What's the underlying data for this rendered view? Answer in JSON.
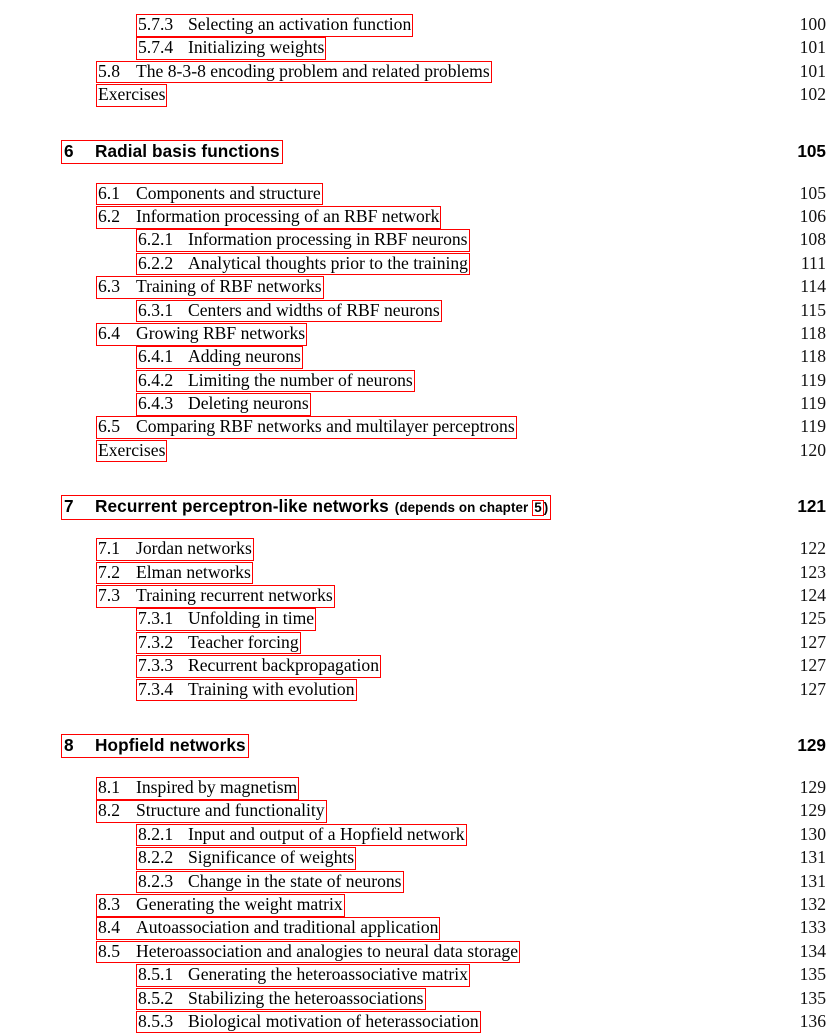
{
  "document": {
    "type": "table-of-contents",
    "accent_box_color": "#ff0000",
    "text_color": "#000000",
    "background": "#ffffff"
  },
  "blocks": [
    {
      "kind": "entries",
      "rows": [
        {
          "level": 3,
          "number": "5.7.3",
          "title": "Selecting an activation function",
          "page": "100"
        },
        {
          "level": 3,
          "number": "5.7.4",
          "title": "Initializing weights",
          "page": "101"
        },
        {
          "level": 2,
          "number": "5.8",
          "title": "The 8-3-8 encoding problem and related problems",
          "page": "101"
        },
        {
          "level": 2,
          "number": "",
          "title": "Exercises",
          "page": "102"
        }
      ]
    },
    {
      "kind": "chapter",
      "chapter": {
        "number": "6",
        "title": "Radial basis functions",
        "page": "105",
        "note_before": "",
        "note_ref": "",
        "note_after": ""
      },
      "rows": [
        {
          "level": 2,
          "number": "6.1",
          "title": "Components and structure",
          "page": "105"
        },
        {
          "level": 2,
          "number": "6.2",
          "title": "Information processing of an RBF network",
          "page": "106"
        },
        {
          "level": 3,
          "number": "6.2.1",
          "title": "Information processing in RBF neurons",
          "page": "108"
        },
        {
          "level": 3,
          "number": "6.2.2",
          "title": "Analytical thoughts prior to the training",
          "page": "111"
        },
        {
          "level": 2,
          "number": "6.3",
          "title": "Training of RBF networks",
          "page": "114"
        },
        {
          "level": 3,
          "number": "6.3.1",
          "title": "Centers and widths of RBF neurons",
          "page": "115"
        },
        {
          "level": 2,
          "number": "6.4",
          "title": "Growing RBF networks",
          "page": "118"
        },
        {
          "level": 3,
          "number": "6.4.1",
          "title": "Adding neurons",
          "page": "118"
        },
        {
          "level": 3,
          "number": "6.4.2",
          "title": "Limiting the number of neurons",
          "page": "119"
        },
        {
          "level": 3,
          "number": "6.4.3",
          "title": "Deleting neurons",
          "page": "119"
        },
        {
          "level": 2,
          "number": "6.5",
          "title": "Comparing RBF networks and multilayer perceptrons",
          "page": "119"
        },
        {
          "level": 2,
          "number": "",
          "title": "Exercises",
          "page": "120"
        }
      ]
    },
    {
      "kind": "chapter",
      "chapter": {
        "number": "7",
        "title": "Recurrent perceptron-like networks",
        "page": "121",
        "note_before": "(depends on chapter ",
        "note_ref": "5",
        "note_after": ")"
      },
      "rows": [
        {
          "level": 2,
          "number": "7.1",
          "title": "Jordan networks",
          "page": "122"
        },
        {
          "level": 2,
          "number": "7.2",
          "title": "Elman networks",
          "page": "123"
        },
        {
          "level": 2,
          "number": "7.3",
          "title": "Training recurrent networks",
          "page": "124"
        },
        {
          "level": 3,
          "number": "7.3.1",
          "title": "Unfolding in time",
          "page": "125"
        },
        {
          "level": 3,
          "number": "7.3.2",
          "title": "Teacher forcing",
          "page": "127"
        },
        {
          "level": 3,
          "number": "7.3.3",
          "title": "Recurrent backpropagation",
          "page": "127"
        },
        {
          "level": 3,
          "number": "7.3.4",
          "title": "Training with evolution",
          "page": "127"
        }
      ]
    },
    {
      "kind": "chapter",
      "chapter": {
        "number": "8",
        "title": "Hopfield networks",
        "page": "129",
        "note_before": "",
        "note_ref": "",
        "note_after": ""
      },
      "rows": [
        {
          "level": 2,
          "number": "8.1",
          "title": "Inspired by magnetism",
          "page": "129"
        },
        {
          "level": 2,
          "number": "8.2",
          "title": "Structure and functionality",
          "page": "129"
        },
        {
          "level": 3,
          "number": "8.2.1",
          "title": "Input and output of a Hopfield network",
          "page": "130"
        },
        {
          "level": 3,
          "number": "8.2.2",
          "title": "Significance of weights",
          "page": "131"
        },
        {
          "level": 3,
          "number": "8.2.3",
          "title": "Change in the state of neurons",
          "page": "131"
        },
        {
          "level": 2,
          "number": "8.3",
          "title": "Generating the weight matrix",
          "page": "132"
        },
        {
          "level": 2,
          "number": "8.4",
          "title": "Autoassociation and traditional application",
          "page": "133"
        },
        {
          "level": 2,
          "number": "8.5",
          "title": "Heteroassociation and analogies to neural data storage",
          "page": "134"
        },
        {
          "level": 3,
          "number": "8.5.1",
          "title": "Generating the heteroassociative matrix",
          "page": "135"
        },
        {
          "level": 3,
          "number": "8.5.2",
          "title": "Stabilizing the heteroassociations",
          "page": "135"
        },
        {
          "level": 3,
          "number": "8.5.3",
          "title": "Biological motivation of heterassociation",
          "page": "136"
        }
      ]
    }
  ]
}
